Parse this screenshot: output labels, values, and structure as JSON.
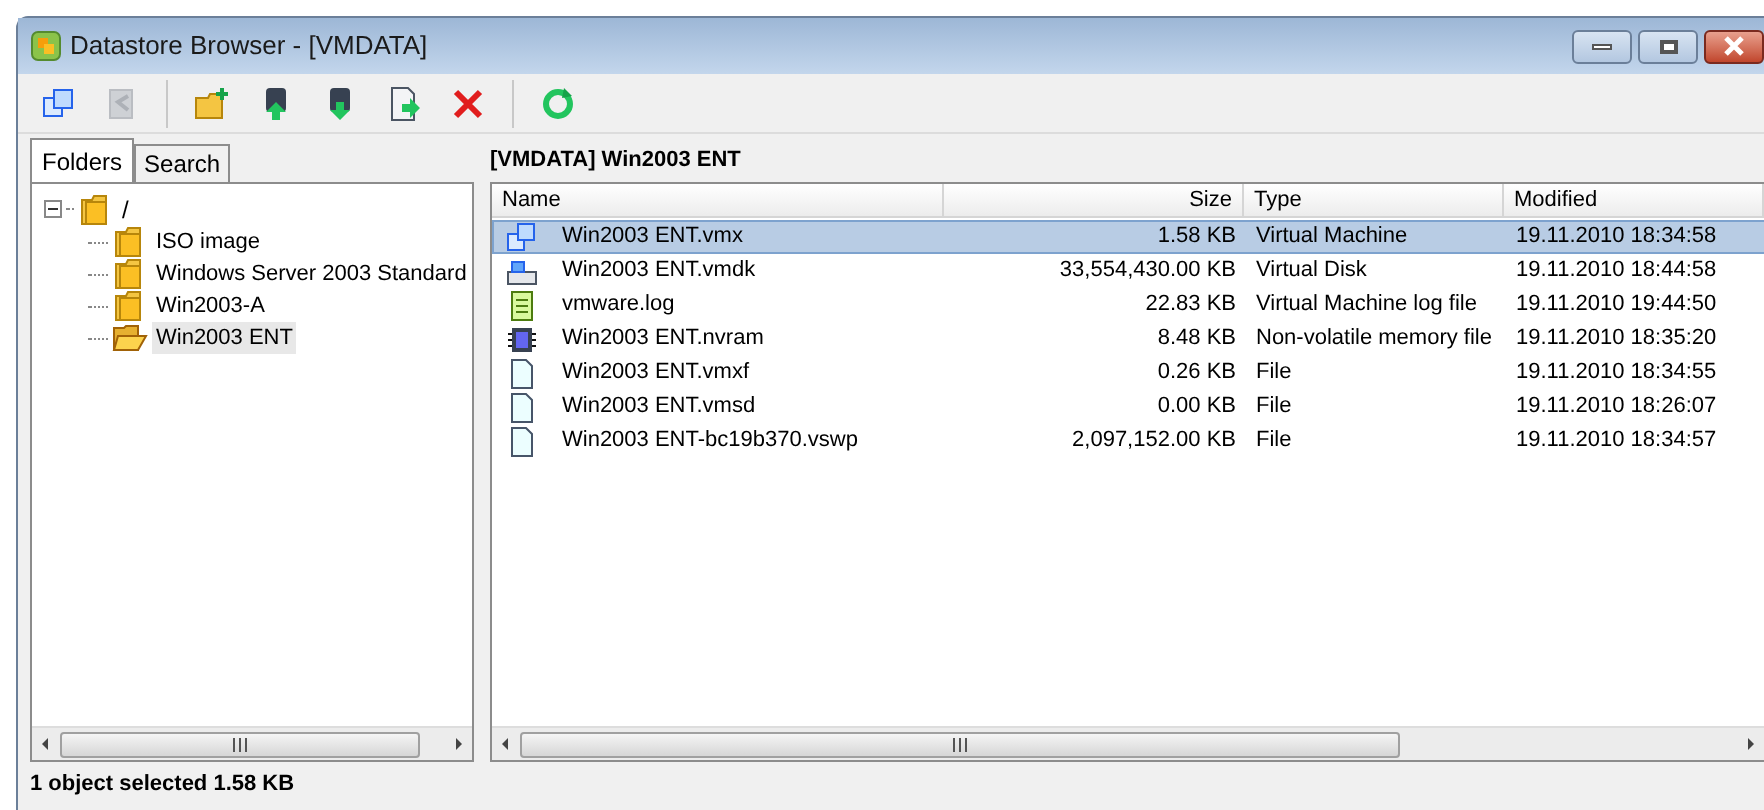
{
  "window": {
    "title": "Datastore Browser - [VMDATA]"
  },
  "toolbar": [
    {
      "kind": "vm",
      "disabled": false
    },
    {
      "kind": "back",
      "disabled": true
    },
    {
      "kind": "newfolder",
      "disabled": false
    },
    {
      "kind": "upload",
      "disabled": false
    },
    {
      "kind": "download",
      "disabled": false
    },
    {
      "kind": "move",
      "disabled": false
    },
    {
      "kind": "delete",
      "disabled": false
    },
    {
      "kind": "refresh",
      "disabled": false
    }
  ],
  "tabs": [
    {
      "label": "Folders",
      "selected": true
    },
    {
      "label": "Search",
      "selected": false
    }
  ],
  "tree": {
    "label": "/",
    "expanded": true,
    "selected": false,
    "children": [
      {
        "label": "ISO image",
        "selected": false,
        "open": false
      },
      {
        "label": "Windows Server 2003 Standard",
        "selected": false,
        "open": false
      },
      {
        "label": "Win2003-A",
        "selected": false,
        "open": false
      },
      {
        "label": "Win2003 ENT",
        "selected": true,
        "open": true
      }
    ]
  },
  "path": "[VMDATA] Win2003 ENT",
  "table": {
    "columns": [
      "Name",
      "Size",
      "Type",
      "Modified"
    ],
    "rows": [
      {
        "kind": "vm",
        "name": "Win2003 ENT.vmx",
        "size": "1.58 KB",
        "type": "Virtual Machine",
        "modified": "19.11.2010 18:34:58",
        "selected": true
      },
      {
        "kind": "disk",
        "name": "Win2003 ENT.vmdk",
        "size": "33,554,430.00 KB",
        "type": "Virtual Disk",
        "modified": "19.11.2010 18:44:58",
        "selected": false
      },
      {
        "kind": "log",
        "name": "vmware.log",
        "size": "22.83 KB",
        "type": "Virtual Machine log file",
        "modified": "19.11.2010 19:44:50",
        "selected": false
      },
      {
        "kind": "nvram",
        "name": "Win2003 ENT.nvram",
        "size": "8.48 KB",
        "type": "Non-volatile memory file",
        "modified": "19.11.2010 18:35:20",
        "selected": false
      },
      {
        "kind": "file",
        "name": "Win2003 ENT.vmxf",
        "size": "0.26 KB",
        "type": "File",
        "modified": "19.11.2010 18:34:55",
        "selected": false
      },
      {
        "kind": "file",
        "name": "Win2003 ENT.vmsd",
        "size": "0.00 KB",
        "type": "File",
        "modified": "19.11.2010 18:26:07",
        "selected": false
      },
      {
        "kind": "file",
        "name": "Win2003 ENT-bc19b370.vswp",
        "size": "2,097,152.00 KB",
        "type": "File",
        "modified": "19.11.2010 18:34:57",
        "selected": false
      }
    ]
  },
  "status": "1 object selected 1.58 KB"
}
